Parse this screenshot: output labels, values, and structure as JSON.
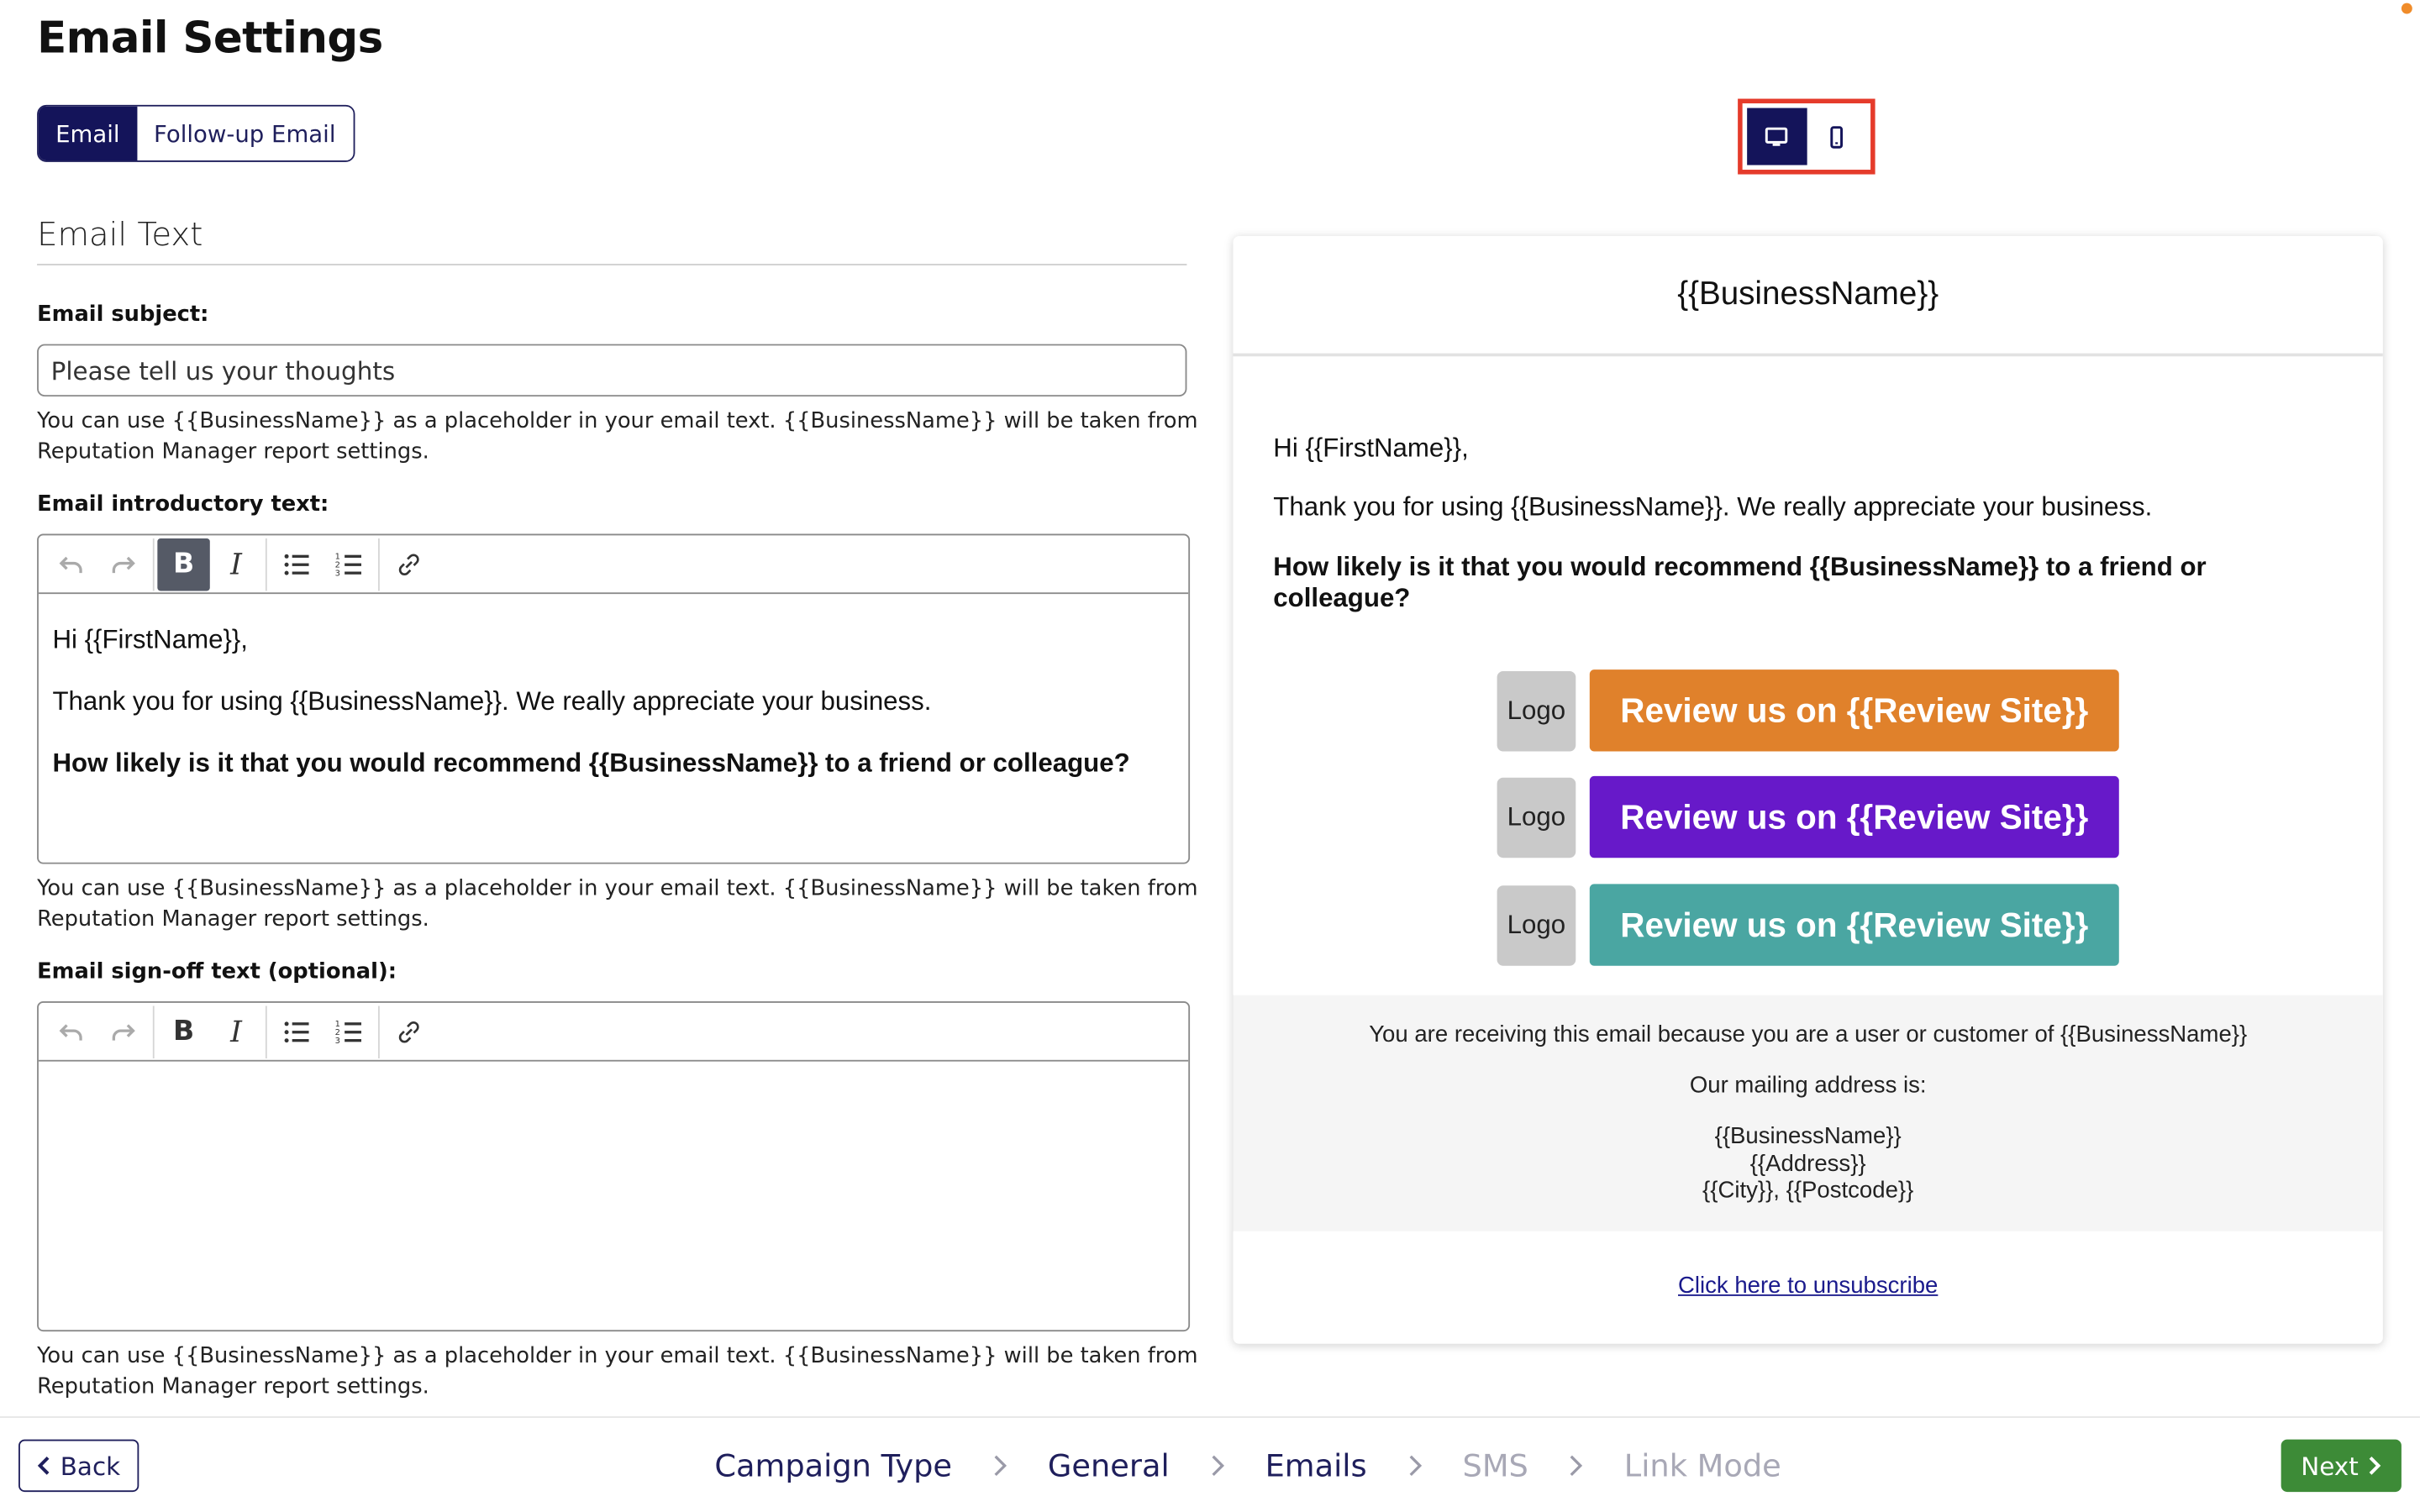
{
  "page": {
    "title": "Email Settings"
  },
  "tabs": [
    {
      "label": "Email",
      "active": true
    },
    {
      "label": "Follow-up Email",
      "active": false
    }
  ],
  "section": {
    "title": "Email Text"
  },
  "subject": {
    "label": "Email subject:",
    "value": "Please tell us your thoughts",
    "help": "You can use {{BusinessName}} as a placeholder in your email text. {{BusinessName}} will be taken from Reputation Manager report settings."
  },
  "intro": {
    "label": "Email introductory text:",
    "lines": [
      "Hi {{FirstName}},",
      "Thank you for using {{BusinessName}}. We really appreciate your business.",
      "How likely is it that you would recommend {{BusinessName}} to a friend or colleague?"
    ],
    "help": "You can use {{BusinessName}} as a placeholder in your email text. {{BusinessName}} will be taken from Reputation Manager report settings."
  },
  "signoff": {
    "label": "Email sign-off text (optional):",
    "value": "",
    "help": "You can use {{BusinessName}} as a placeholder in your email text. {{BusinessName}} will be taken from Reputation Manager report settings."
  },
  "toolbar": {
    "icons": [
      "undo-icon",
      "redo-icon",
      "bold-icon",
      "italic-icon",
      "bulleted-list-icon",
      "numbered-list-icon",
      "link-icon"
    ],
    "bold_label": "B",
    "italic_label": "I"
  },
  "device_toggle": {
    "active": "desktop",
    "icons": [
      "desktop-icon",
      "mobile-icon"
    ]
  },
  "preview": {
    "header": "{{BusinessName}}",
    "greeting": "Hi {{FirstName}},",
    "thanks": "Thank you for using {{BusinessName}}. We really appreciate your business.",
    "question": "How likely is it that you would recommend {{BusinessName}} to a friend or colleague?",
    "reviews": [
      {
        "logo": "Logo",
        "label": "Review us on {{Review Site}}",
        "color": "#e0812b"
      },
      {
        "logo": "Logo",
        "label": "Review us on {{Review Site}}",
        "color": "#6719c9"
      },
      {
        "logo": "Logo",
        "label": "Review us on {{Review Site}}",
        "color": "#4aa6a2"
      }
    ],
    "footer": {
      "reason": "You are receiving this email because you are a user or customer of {{BusinessName}}",
      "mailing_label": "Our mailing address is:",
      "address_lines": [
        "{{BusinessName}}",
        "{{Address}}",
        "{{City}}, {{Postcode}}"
      ]
    },
    "unsubscribe": "Click here to unsubscribe"
  },
  "nav": {
    "back_label": "Back",
    "next_label": "Next",
    "steps": [
      {
        "label": "Campaign Type",
        "state": "done"
      },
      {
        "label": "General",
        "state": "done"
      },
      {
        "label": "Emails",
        "state": "done"
      },
      {
        "label": "SMS",
        "state": "future"
      },
      {
        "label": "Link Mode",
        "state": "future"
      }
    ]
  },
  "colors": {
    "primary": "#14145a",
    "next_button": "#3d8b37",
    "highlight_border": "#e53b2b",
    "notification_dot": "#f08c2a"
  }
}
